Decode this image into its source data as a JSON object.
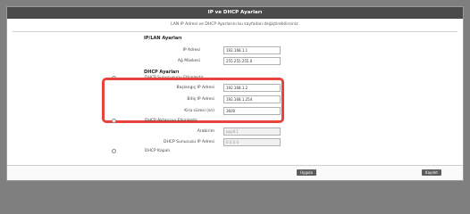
{
  "window": {
    "title": "IP ve DHCP Ayarları"
  },
  "hint": "LAN IP Adresi ve DHCP Ayarlarını bu sayfadan değiştirebilirsiniz.",
  "ip": {
    "section_title": "IP/LAN Ayarları",
    "ip_label": "IP Adresi",
    "ip_value": "192.168.1.1",
    "mask_label": "Ağ Maskesi",
    "mask_value": "255.255.255.0"
  },
  "dhcp": {
    "section_title": "DHCP Ayarları",
    "server": {
      "label": "DHCP Sunucusunu Etkinleştir",
      "start_label": "Başlangıç IP Adresi",
      "start_value": "192.168.1.2",
      "end_label": "Bitiş IP Adresi",
      "end_value": "192.168.1.254",
      "lease_label": "Kira süresi (sn)",
      "lease_value": "3600"
    },
    "relay": {
      "label": "DHCP Aktarıcıyı Etkinleştir",
      "interface_label": "Arabirim",
      "interface_value": "ppp0.1",
      "server_ip_label": "DHCP Sunucusu IP Adresi",
      "server_ip_value": "0.0.0.0"
    },
    "disabled": {
      "label": "DHCP Kapalı"
    }
  },
  "buttons": {
    "apply": "Uygula",
    "save": "Kaydet"
  },
  "colors": {
    "highlight": "#e8443b",
    "titlebar": "#4a4a4a"
  }
}
